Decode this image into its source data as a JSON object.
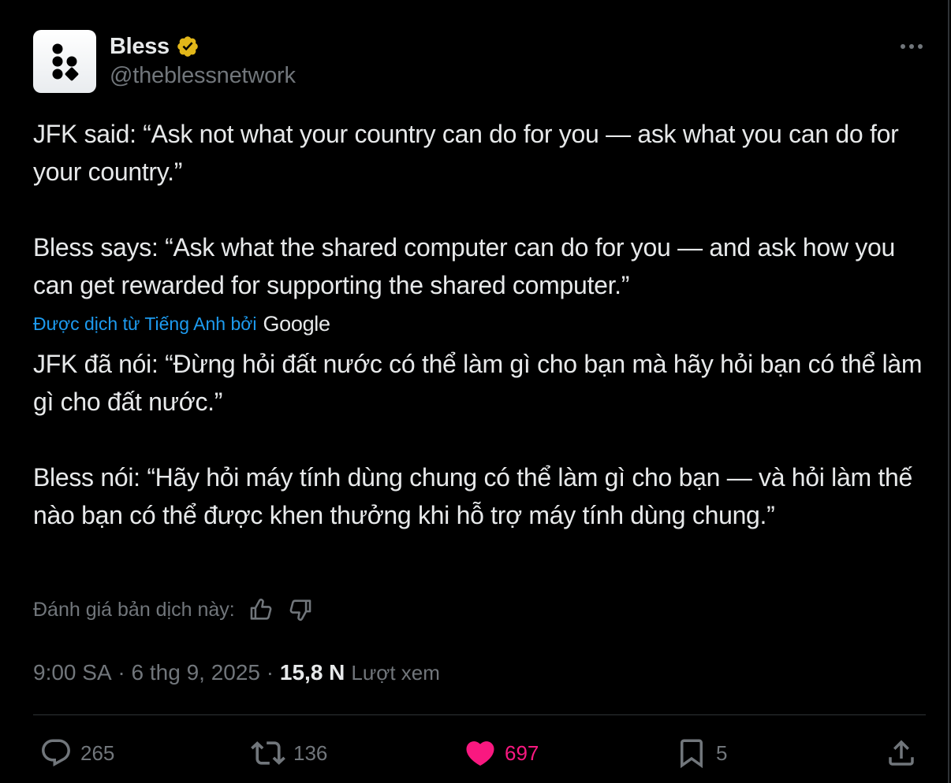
{
  "author": {
    "name": "Bless",
    "handle": "@theblessnetwork",
    "avatar_icon": "bless-logo",
    "verified": true,
    "badge_color": "#e2b719"
  },
  "menu": {
    "icon": "more-horizontal-icon"
  },
  "tweet": {
    "text_original": "JFK said: “Ask not what your country can do for you — ask what you can do for your country.”\n\nBless says: “Ask what the shared computer can do for you — and ask how you can get rewarded for supporting the shared computer.”",
    "translation_label": "Được dịch từ Tiếng Anh bởi",
    "translation_provider": "Google",
    "text_translated": "JFK đã nói: “Đừng hỏi đất nước có thể làm gì cho bạn mà hãy hỏi bạn có thể làm gì cho đất nước.”\n\nBless nói: “Hãy hỏi máy tính dùng chung có thể làm gì cho bạn — và hỏi làm thế nào bạn có thể được khen thưởng khi hỗ trợ máy tính dùng chung.”"
  },
  "rating": {
    "label": "Đánh giá bản dịch này:",
    "up_icon": "thumbs-up-icon",
    "down_icon": "thumbs-down-icon"
  },
  "meta": {
    "time": "9:00 SA",
    "separator": " · ",
    "date": "6 thg 9, 2025",
    "views_count": "15,8 N",
    "views_label": "Lượt xem"
  },
  "actions": {
    "replies": "265",
    "retweets": "136",
    "likes": "697",
    "bookmarks": "5",
    "liked": true,
    "like_color": "#f91880"
  },
  "colors": {
    "background": "#000000",
    "text_primary": "#e7e9ea",
    "text_secondary": "#71767b",
    "link": "#1d9bf0",
    "divider": "#2f3336"
  }
}
